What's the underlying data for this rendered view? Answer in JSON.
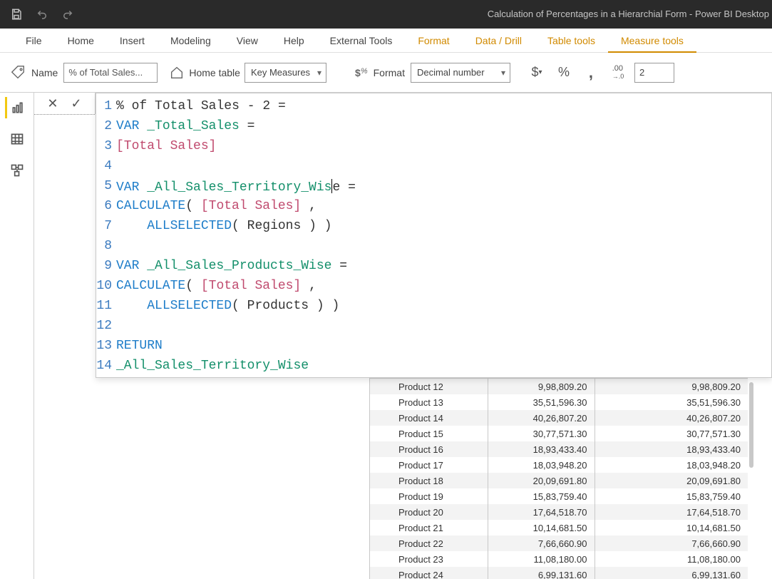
{
  "title_bar": {
    "title": "Calculation of Percentages in a Hierarchial Form - Power BI Desktop"
  },
  "ribbon_tabs": [
    "File",
    "Home",
    "Insert",
    "Modeling",
    "View",
    "Help",
    "External Tools",
    "Format",
    "Data / Drill",
    "Table tools",
    "Measure tools"
  ],
  "active_tab_index": 10,
  "contextual_range_start": 7,
  "name_field": {
    "label": "Name",
    "value": "% of Total Sales..."
  },
  "home_table": {
    "label": "Home table",
    "value": "Key Measures"
  },
  "format_field": {
    "label": "Format",
    "value": "Decimal number"
  },
  "decimals": {
    "value": "2"
  },
  "formula_lines": [
    "% of Total Sales - 2 =",
    "VAR _Total_Sales =",
    "[Total Sales]",
    "",
    "VAR _All_Sales_Territory_Wise =",
    "CALCULATE( [Total Sales] ,",
    "    ALLSELECTED( Regions ) )",
    "",
    "VAR _All_Sales_Products_Wise =",
    "CALCULATE( [Total Sales] ,",
    "    ALLSELECTED( Products ) )",
    "",
    "RETURN",
    "_All_Sales_Territory_Wise"
  ],
  "table_rows": [
    {
      "product": "Product 12",
      "col2": "9,98,809.20",
      "col3": "9,98,809.20"
    },
    {
      "product": "Product 13",
      "col2": "35,51,596.30",
      "col3": "35,51,596.30"
    },
    {
      "product": "Product 14",
      "col2": "40,26,807.20",
      "col3": "40,26,807.20"
    },
    {
      "product": "Product 15",
      "col2": "30,77,571.30",
      "col3": "30,77,571.30"
    },
    {
      "product": "Product 16",
      "col2": "18,93,433.40",
      "col3": "18,93,433.40"
    },
    {
      "product": "Product 17",
      "col2": "18,03,948.20",
      "col3": "18,03,948.20"
    },
    {
      "product": "Product 18",
      "col2": "20,09,691.80",
      "col3": "20,09,691.80"
    },
    {
      "product": "Product 19",
      "col2": "15,83,759.40",
      "col3": "15,83,759.40"
    },
    {
      "product": "Product 20",
      "col2": "17,64,518.70",
      "col3": "17,64,518.70"
    },
    {
      "product": "Product 21",
      "col2": "10,14,681.50",
      "col3": "10,14,681.50"
    },
    {
      "product": "Product 22",
      "col2": "7,66,660.90",
      "col3": "7,66,660.90"
    },
    {
      "product": "Product 23",
      "col2": "11,08,180.00",
      "col3": "11,08,180.00"
    },
    {
      "product": "Product 24",
      "col2": "6,99,131.60",
      "col3": "6,99,131.60"
    }
  ]
}
